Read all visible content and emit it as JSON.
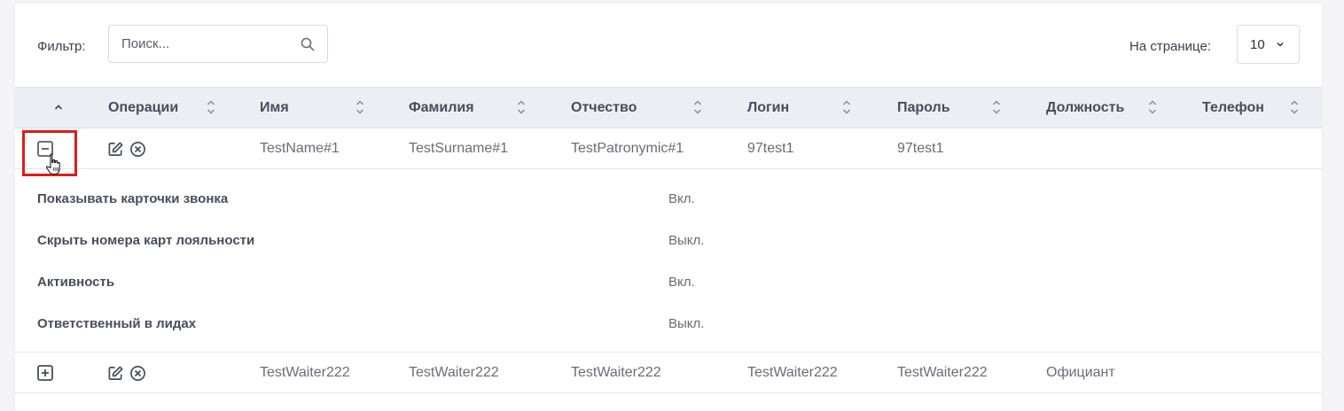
{
  "toolbar": {
    "filter_label": "Фильтр:",
    "search_placeholder": "Поиск...",
    "search_value": "",
    "per_page_label": "На странице:",
    "per_page_value": "10"
  },
  "table": {
    "columns": [
      "Операции",
      "Имя",
      "Фамилия",
      "Отчество",
      "Логин",
      "Пароль",
      "Должность",
      "Телефон"
    ],
    "rows": [
      {
        "expanded": true,
        "name": "TestName#1",
        "surname": "TestSurname#1",
        "patronymic": "TestPatronymic#1",
        "login": "97test1",
        "password": "97test1",
        "position": "",
        "details": [
          {
            "label": "Показывать карточки звонка",
            "value": "Вкл."
          },
          {
            "label": "Скрыть номера карт лояльности",
            "value": "Выкл."
          },
          {
            "label": "Активность",
            "value": "Вкл."
          },
          {
            "label": "Ответственный в лидах",
            "value": "Выкл."
          }
        ]
      },
      {
        "expanded": false,
        "name": "TestWaiter222",
        "surname": "TestWaiter222",
        "patronymic": "TestWaiter222",
        "login": "TestWaiter222",
        "password": "TestWaiter222",
        "position": "Официант"
      }
    ]
  },
  "icons": {
    "search": "search-icon",
    "chevron": "chevron-down-icon",
    "sort": "sort-icon",
    "edit": "edit-icon",
    "delete": "delete-icon",
    "expand": "plus-square-icon",
    "collapse": "minus-square-icon",
    "cursor": "hand-pointer-icon"
  },
  "colors": {
    "highlight": "#e01a1a",
    "header_bg": "#eceef3"
  }
}
